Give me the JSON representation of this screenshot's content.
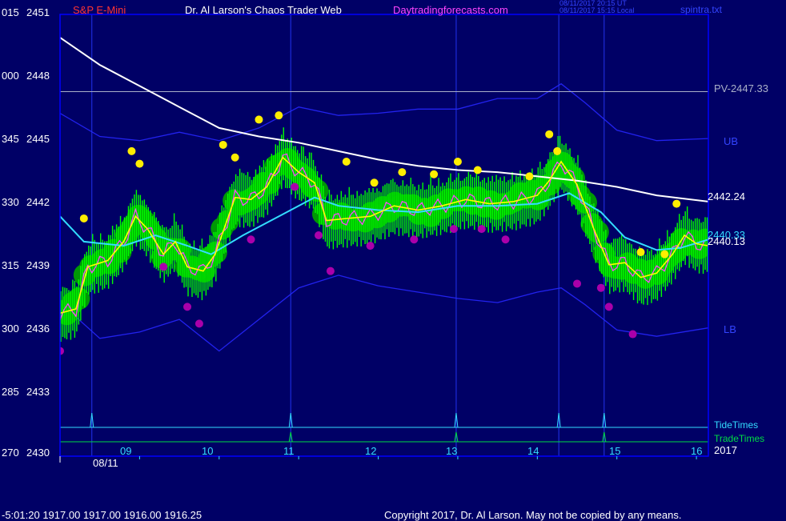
{
  "header": {
    "symbol": "S&P E-Mini",
    "site_title": "Dr. Al Larson's Chaos Trader Web",
    "site_url": "Daytradingforecasts.com",
    "timestamp_utc": "08/11/2017 20:15 UT",
    "timestamp_local": "08/11/2017 15:15 Local",
    "file_name": "spintra.txt"
  },
  "footer": {
    "quote": "-5:01:20  1917.00 1917.00 1916.00 1916.25",
    "copyright": "Copyright 2017, Dr. Al Larson. May not be copied by any means."
  },
  "colors": {
    "background": "#000066",
    "frame": "#0000ff",
    "price_bars": "#00ff00",
    "bands": "#2222ee",
    "fast_avg": "#ffff00",
    "mid_avg": "#33ddff",
    "slow_avg": "#ffffff",
    "trace": "#ff44ff",
    "highs": "#ffee00",
    "lows": "#aa00aa",
    "tide_times": "#33ddff",
    "trade_times": "#00dd44"
  },
  "chart_data": {
    "type": "line",
    "title": "S&P E-Mini",
    "y_left_labels": [
      {
        "left": "015",
        "right": "2451"
      },
      {
        "left": "000",
        "right": "2448"
      },
      {
        "left": "345",
        "right": "2445"
      },
      {
        "left": "330",
        "right": "2442"
      },
      {
        "left": "315",
        "right": "2439"
      },
      {
        "left": "300",
        "right": "2436"
      },
      {
        "left": "285",
        "right": "2433"
      },
      {
        "left": "270",
        "right": "2430"
      }
    ],
    "ylim": [
      2430,
      2451
    ],
    "x_ticks": [
      "09",
      "10",
      "11",
      "12",
      "13",
      "14",
      "15",
      "16"
    ],
    "x_tick_hours": [
      9,
      10,
      11,
      12,
      13,
      14,
      15,
      16
    ],
    "xlim": [
      8.0,
      16.15
    ],
    "date_label": "08/11",
    "year_label": "2017",
    "pivot": {
      "label": "PV-2447.33",
      "value": 2447.33
    },
    "band_labels": {
      "upper": "UB",
      "lower": "LB"
    },
    "end_values": {
      "slow": "2442.24",
      "mid": "2440.33",
      "fast": "2440.13"
    },
    "legend": [
      "TideTimes",
      "TradeTimes"
    ],
    "tide_times": [
      8.4,
      10.9,
      12.98,
      14.27,
      14.84
    ],
    "trade_times": [
      10.9,
      12.98,
      14.84
    ],
    "slow_avg": [
      [
        8.0,
        2449.9
      ],
      [
        8.5,
        2448.6
      ],
      [
        9.0,
        2447.6
      ],
      [
        9.5,
        2446.6
      ],
      [
        10.0,
        2445.6
      ],
      [
        10.5,
        2445.2
      ],
      [
        11.0,
        2444.9
      ],
      [
        11.5,
        2444.5
      ],
      [
        12.0,
        2444.1
      ],
      [
        12.5,
        2443.8
      ],
      [
        13.0,
        2443.6
      ],
      [
        13.5,
        2443.5
      ],
      [
        14.0,
        2443.3
      ],
      [
        14.5,
        2443.1
      ],
      [
        15.0,
        2442.8
      ],
      [
        15.5,
        2442.4
      ],
      [
        16.15,
        2442.1
      ]
    ],
    "mid_avg": [
      [
        8.0,
        2441.4
      ],
      [
        8.3,
        2440.2
      ],
      [
        8.8,
        2440.0
      ],
      [
        9.2,
        2440.5
      ],
      [
        9.6,
        2440.0
      ],
      [
        9.9,
        2439.6
      ],
      [
        10.3,
        2440.5
      ],
      [
        10.8,
        2441.5
      ],
      [
        11.2,
        2442.3
      ],
      [
        11.5,
        2441.9
      ],
      [
        12.0,
        2441.7
      ],
      [
        12.5,
        2441.6
      ],
      [
        13.0,
        2441.9
      ],
      [
        13.5,
        2441.9
      ],
      [
        14.0,
        2442.0
      ],
      [
        14.4,
        2442.5
      ],
      [
        14.8,
        2441.6
      ],
      [
        15.1,
        2440.4
      ],
      [
        15.5,
        2439.8
      ],
      [
        15.8,
        2439.9
      ],
      [
        16.15,
        2440.3
      ]
    ],
    "fast_avg": [
      [
        8.0,
        2436.8
      ],
      [
        8.2,
        2437.0
      ],
      [
        8.35,
        2439.0
      ],
      [
        8.6,
        2439.3
      ],
      [
        8.8,
        2440.2
      ],
      [
        8.95,
        2441.4
      ],
      [
        9.1,
        2440.8
      ],
      [
        9.3,
        2439.6
      ],
      [
        9.45,
        2440.2
      ],
      [
        9.6,
        2439.0
      ],
      [
        9.8,
        2438.8
      ],
      [
        9.95,
        2439.6
      ],
      [
        10.2,
        2442.3
      ],
      [
        10.4,
        2442.2
      ],
      [
        10.6,
        2442.8
      ],
      [
        10.8,
        2444.2
      ],
      [
        11.0,
        2443.5
      ],
      [
        11.2,
        2443.0
      ],
      [
        11.35,
        2441.2
      ],
      [
        11.6,
        2441.3
      ],
      [
        11.9,
        2441.4
      ],
      [
        12.2,
        2441.9
      ],
      [
        12.5,
        2441.7
      ],
      [
        12.8,
        2441.9
      ],
      [
        13.1,
        2442.2
      ],
      [
        13.4,
        2442.0
      ],
      [
        13.7,
        2442.1
      ],
      [
        14.0,
        2442.4
      ],
      [
        14.15,
        2443.1
      ],
      [
        14.3,
        2444.0
      ],
      [
        14.5,
        2442.9
      ],
      [
        14.7,
        2440.9
      ],
      [
        14.9,
        2439.1
      ],
      [
        15.1,
        2439.2
      ],
      [
        15.3,
        2438.5
      ],
      [
        15.5,
        2438.7
      ],
      [
        15.7,
        2439.6
      ],
      [
        15.85,
        2440.5
      ],
      [
        16.0,
        2440.1
      ],
      [
        16.15,
        2440.0
      ]
    ],
    "upper_band": [
      [
        8.0,
        2446.3
      ],
      [
        8.5,
        2445.2
      ],
      [
        9.0,
        2445.0
      ],
      [
        9.5,
        2445.4
      ],
      [
        10.0,
        2445.0
      ],
      [
        10.5,
        2445.6
      ],
      [
        11.0,
        2446.6
      ],
      [
        11.5,
        2446.2
      ],
      [
        12.0,
        2446.3
      ],
      [
        12.5,
        2446.5
      ],
      [
        13.0,
        2446.5
      ],
      [
        13.5,
        2447.0
      ],
      [
        14.0,
        2447.0
      ],
      [
        14.3,
        2447.7
      ],
      [
        14.6,
        2446.8
      ],
      [
        15.0,
        2445.5
      ],
      [
        15.5,
        2445.0
      ],
      [
        16.15,
        2445.1
      ]
    ],
    "lower_band": [
      [
        8.0,
        2437.3
      ],
      [
        8.5,
        2435.6
      ],
      [
        9.0,
        2435.9
      ],
      [
        9.5,
        2436.5
      ],
      [
        10.0,
        2435.0
      ],
      [
        10.5,
        2436.5
      ],
      [
        11.0,
        2438.0
      ],
      [
        11.5,
        2438.6
      ],
      [
        12.0,
        2438.1
      ],
      [
        12.5,
        2437.8
      ],
      [
        13.0,
        2437.5
      ],
      [
        13.5,
        2437.3
      ],
      [
        14.0,
        2437.8
      ],
      [
        14.3,
        2438.0
      ],
      [
        14.6,
        2437.2
      ],
      [
        15.0,
        2436.0
      ],
      [
        15.5,
        2435.7
      ],
      [
        16.15,
        2436.1
      ]
    ],
    "swing_highs": [
      [
        8.3,
        2441.3
      ],
      [
        8.9,
        2444.5
      ],
      [
        9.0,
        2443.9
      ],
      [
        10.05,
        2444.8
      ],
      [
        10.2,
        2444.2
      ],
      [
        10.5,
        2446.0
      ],
      [
        10.75,
        2446.2
      ],
      [
        11.6,
        2444.0
      ],
      [
        11.95,
        2443.0
      ],
      [
        12.3,
        2443.5
      ],
      [
        12.7,
        2443.4
      ],
      [
        13.0,
        2444.0
      ],
      [
        13.25,
        2443.6
      ],
      [
        13.9,
        2443.3
      ],
      [
        14.15,
        2445.3
      ],
      [
        14.25,
        2444.5
      ],
      [
        15.3,
        2439.7
      ],
      [
        15.6,
        2439.6
      ],
      [
        15.75,
        2442.0
      ]
    ],
    "swing_lows": [
      [
        8.0,
        2435.0
      ],
      [
        9.3,
        2439.0
      ],
      [
        9.6,
        2437.1
      ],
      [
        9.75,
        2436.3
      ],
      [
        10.4,
        2440.3
      ],
      [
        10.95,
        2442.8
      ],
      [
        11.25,
        2440.5
      ],
      [
        11.4,
        2438.8
      ],
      [
        11.9,
        2440.0
      ],
      [
        12.45,
        2440.3
      ],
      [
        12.95,
        2440.8
      ],
      [
        13.3,
        2440.8
      ],
      [
        13.6,
        2440.3
      ],
      [
        14.5,
        2438.2
      ],
      [
        14.8,
        2438.0
      ],
      [
        14.9,
        2437.1
      ],
      [
        15.2,
        2435.8
      ]
    ]
  }
}
